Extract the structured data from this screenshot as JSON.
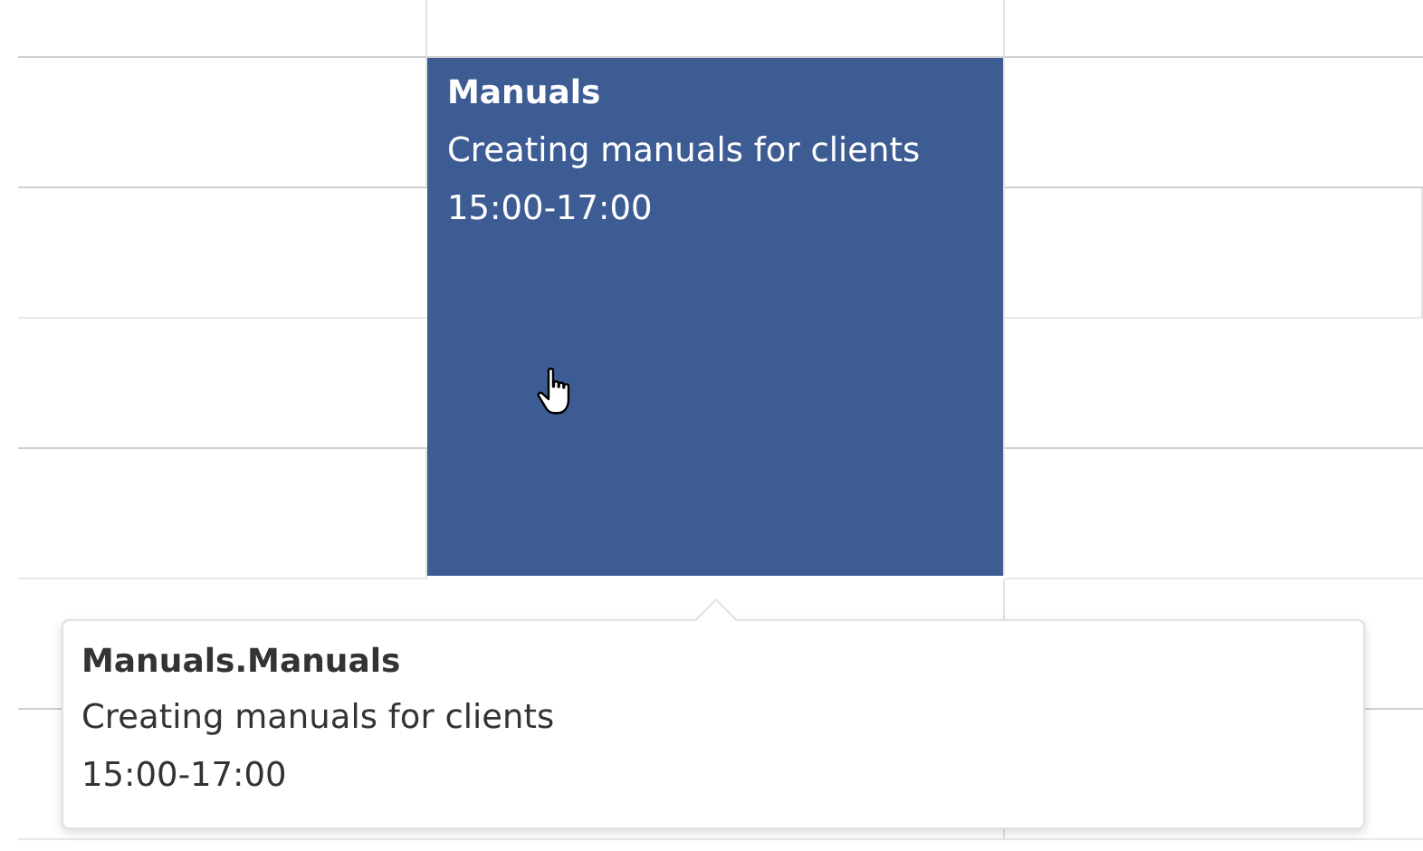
{
  "event": {
    "title": "Manuals",
    "description": "Creating manuals for clients",
    "time": "15:00-17:00"
  },
  "tooltip": {
    "title": "Manuals.Manuals",
    "description": "Creating manuals for clients",
    "time": "15:00-17:00"
  }
}
